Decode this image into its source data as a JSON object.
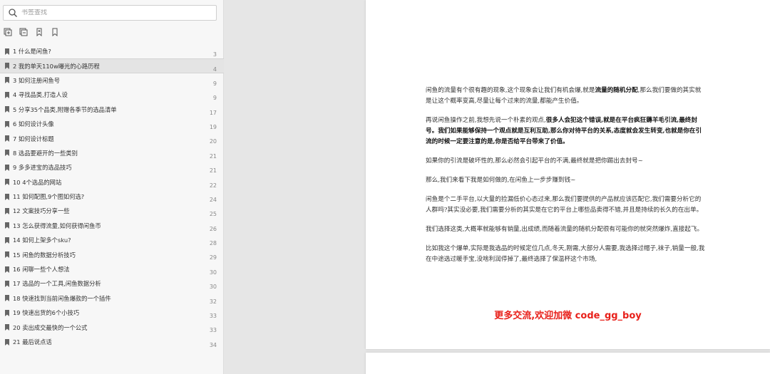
{
  "search": {
    "placeholder": "书签查找"
  },
  "toolbar": {
    "buttons": [
      {
        "name": "expand-all",
        "icon": "expand-all-icon"
      },
      {
        "name": "collapse-all",
        "icon": "collapse-all-icon"
      },
      {
        "name": "add-bookmark",
        "icon": "add-bookmark-icon"
      },
      {
        "name": "bookmark-outline",
        "icon": "bookmark-outline-icon"
      }
    ]
  },
  "toc": {
    "selected_index": 1,
    "items": [
      {
        "label": "1 什么是闲鱼?",
        "page": "3"
      },
      {
        "label": "2 我的单天110w曝光的心路历程",
        "page": "4"
      },
      {
        "label": "3 如何注册闲鱼号",
        "page": "9"
      },
      {
        "label": "4 寻找品类,打造人设",
        "page": "9"
      },
      {
        "label": "5 分享35个品类,附赠各季节的选品清单",
        "page": "17"
      },
      {
        "label": "6 如何设计头像",
        "page": "19"
      },
      {
        "label": "7 如何设计标题",
        "page": "20"
      },
      {
        "label": "8 选品要避开的一些类别",
        "page": "21"
      },
      {
        "label": "9 多多进宝的选品技巧",
        "page": "21"
      },
      {
        "label": "10 4个选品的网站",
        "page": "22"
      },
      {
        "label": "11 如何配图,9个图如何选?",
        "page": "24"
      },
      {
        "label": "12 文案技巧分享一些",
        "page": "25"
      },
      {
        "label": "13 怎么获得流量,如何获得闲鱼币",
        "page": "26"
      },
      {
        "label": "14 如何上架多个sku?",
        "page": "28"
      },
      {
        "label": "15 闲鱼的数据分析技巧",
        "page": "29"
      },
      {
        "label": "16 闲聊一些个人想法",
        "page": "30"
      },
      {
        "label": "17 选品的一个工具,闲鱼数据分析",
        "page": "30"
      },
      {
        "label": "18 快速找到当前闲鱼爆款的一个插件",
        "page": "32"
      },
      {
        "label": "19 快速出货的6个小技巧",
        "page": "33"
      },
      {
        "label": "20 卖出成交最快的一个公式",
        "page": "33"
      },
      {
        "label": "21 最后说点话",
        "page": "34"
      }
    ]
  },
  "document": {
    "paragraphs": [
      [
        {
          "text": "闲鱼的流量有个很有趣的现象,这个现象会让我们有机会爆,就是",
          "bold": false
        },
        {
          "text": "流量的随机分配",
          "bold": true
        },
        {
          "text": ",那么我们要做的其实就是让这个概率变高,尽量让每个过来的流量,都能产生价值。",
          "bold": false
        }
      ],
      [
        {
          "text": "再说闲鱼操作之前,我想先说一个朴素的观点,",
          "bold": false
        },
        {
          "text": "很多人会犯这个错误,就是在平台疯狂薅羊毛引流,最终封号。我们如果能够保持一个观点就是互利互助,那么你对待平台的关系,态度就会发生转变,也就是你在引流的时候一定要注意的是,你是否给平台带来了价值。",
          "bold": true
        }
      ],
      [
        {
          "text": "如果你的引流是破坏性的,那么必然会引起平台的不满,最终就是把你踢出去封号~",
          "bold": false
        }
      ],
      [
        {
          "text": "那么,我们来看下我是如何做的,在闲鱼上一步步赚到钱~",
          "bold": false
        }
      ],
      [
        {
          "text": "闲鱼是个二手平台,以大量的捡漏低价心态过来,那么我们要提供的产品就应该匹配它,我们需要分析它的人群吗?其实没必要,我们需要分析的其实是在它的平台上哪些品卖得不错,并且是持续的长久的在出单。",
          "bold": false
        }
      ],
      [
        {
          "text": "我们选择这类,大概率就能够有销量,出成绩,而随着流量的随机分配很有可能你的就突然爆炸,直接起飞。",
          "bold": false
        }
      ],
      [
        {
          "text": "比如我这个爆单,实际是我选品的时候定位几点,冬天,刚需,大部分人需要,我选择过帽子,袜子,销量一般,我在中途选过暖手宝,没啥利润停掉了,最终选择了保温杯这个市场,",
          "bold": false
        }
      ]
    ],
    "promo": "更多交流,欢迎加微 code_gg_boy"
  },
  "colors": {
    "promo": "#e8201a",
    "sidebar_bg": "#f7f7f7",
    "doc_bg": "#e6e6e6",
    "selected_row": "#e4e4e4"
  }
}
